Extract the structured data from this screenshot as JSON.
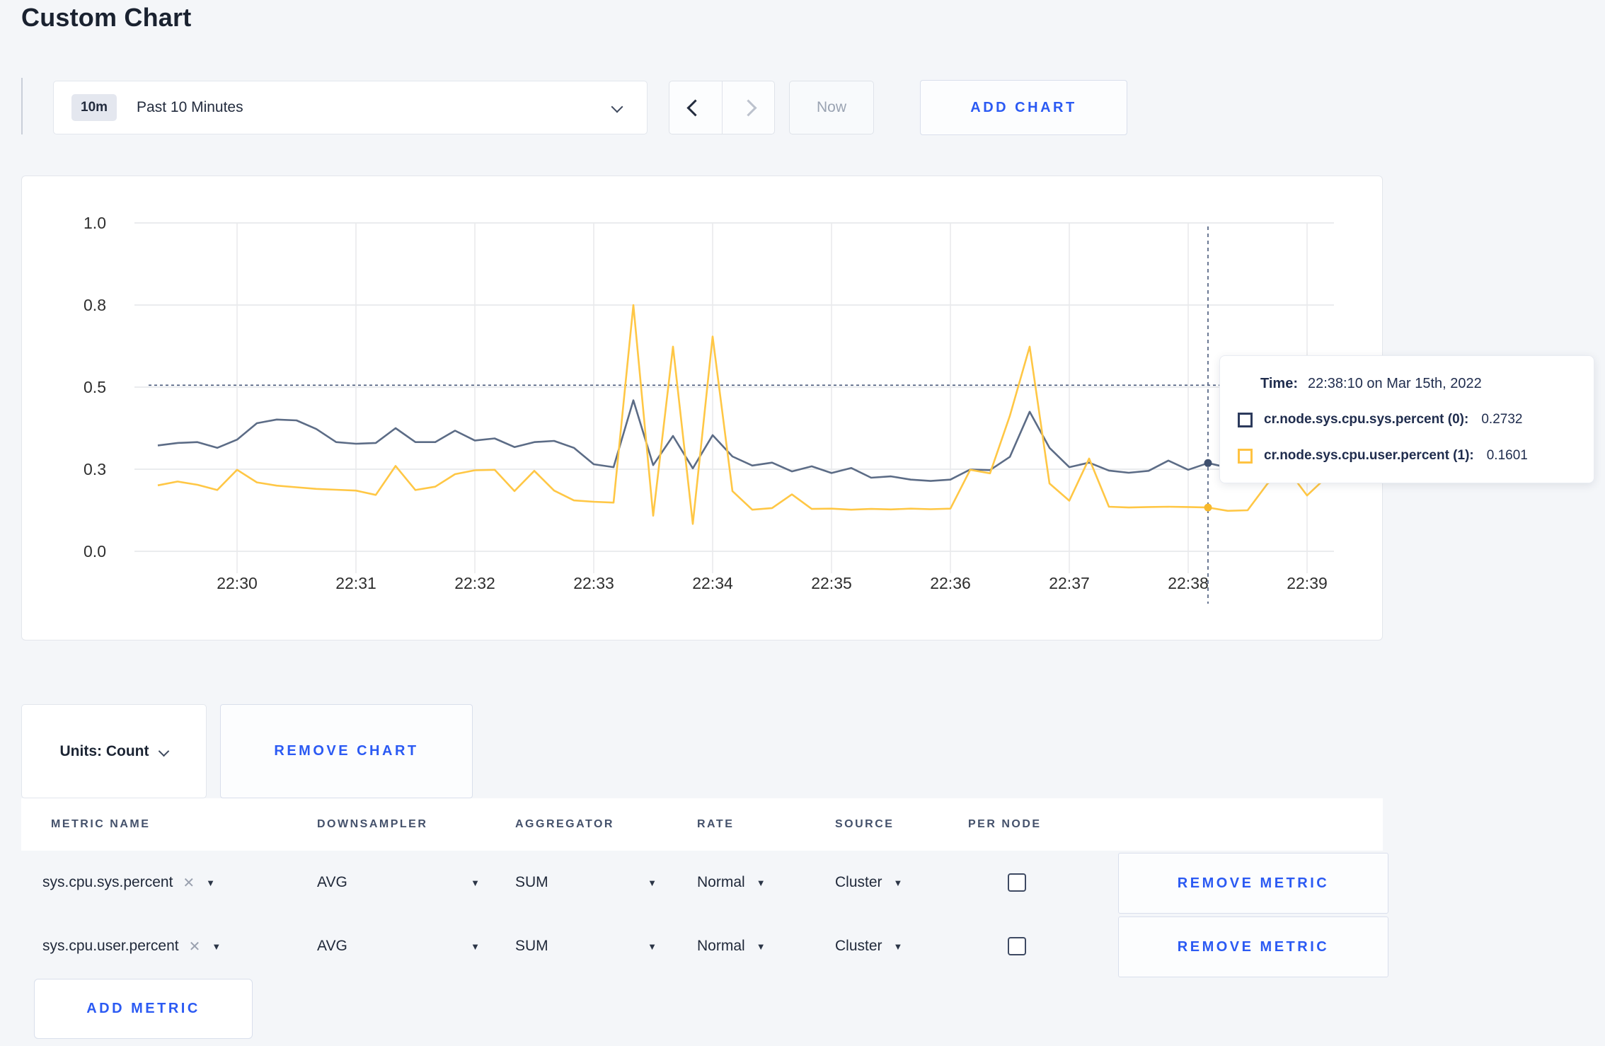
{
  "page_title": "Custom Chart",
  "colors": {
    "accent_blue": "#2b5af3",
    "series_sys": "#5c6c86",
    "series_user": "#ffc745",
    "crosshair": "#47587a",
    "grid": "#e4e6e8"
  },
  "toolbar": {
    "time_badge": "10m",
    "time_label": "Past 10 Minutes",
    "now_label": "Now",
    "add_chart_label": "ADD CHART"
  },
  "chart_controls": {
    "units_label": "Units: Count",
    "remove_chart_label": "REMOVE CHART"
  },
  "tooltip": {
    "time_label": "Time:",
    "time_value": "22:38:10 on Mar 15th, 2022",
    "rows": [
      {
        "label": "cr.node.sys.cpu.sys.percent (0):",
        "value": "0.2732",
        "color": "#2c3a5c"
      },
      {
        "label": "cr.node.sys.cpu.user.percent (1):",
        "value": "0.1601",
        "color": "#ffc342"
      }
    ]
  },
  "chart_data": {
    "type": "line",
    "title": "",
    "xlabel": "",
    "ylabel": "",
    "y_ticks": [
      0.0,
      0.3,
      0.5,
      0.8,
      1.0
    ],
    "y_ticks_evenly_spaced": true,
    "x_tick_labels": [
      "22:30",
      "22:31",
      "22:32",
      "22:33",
      "22:34",
      "22:35",
      "22:36",
      "22:37",
      "22:38",
      "22:39"
    ],
    "points_start_offset_sec": -40,
    "points_step_sec": 10,
    "series": [
      {
        "name": "cr.node.sys.cpu.sys.percent",
        "color": "#5c6c86",
        "values": [
          0.358,
          0.364,
          0.366,
          0.352,
          0.372,
          0.412,
          0.421,
          0.419,
          0.398,
          0.366,
          0.362,
          0.364,
          0.4,
          0.366,
          0.366,
          0.394,
          0.37,
          0.375,
          0.354,
          0.366,
          0.369,
          0.352,
          0.312,
          0.305,
          0.468,
          0.31,
          0.381,
          0.302,
          0.383,
          0.331,
          0.309,
          0.316,
          0.292,
          0.307,
          0.286,
          0.303,
          0.269,
          0.274,
          0.262,
          0.257,
          0.262,
          0.299,
          0.297,
          0.33,
          0.44,
          0.352,
          0.305,
          0.316,
          0.295,
          0.287,
          0.294,
          0.321,
          0.298,
          0.315,
          0.304,
          0.296,
          0.301,
          0.296,
          0.3,
          0.297
        ]
      },
      {
        "name": "cr.node.sys.cpu.user.percent",
        "color": "#ffc745",
        "values": [
          0.241,
          0.255,
          0.243,
          0.224,
          0.298,
          0.252,
          0.24,
          0.234,
          0.228,
          0.225,
          0.222,
          0.206,
          0.308,
          0.224,
          0.236,
          0.282,
          0.296,
          0.298,
          0.22,
          0.294,
          0.222,
          0.186,
          0.181,
          0.178,
          0.8,
          0.13,
          0.648,
          0.1,
          0.685,
          0.22,
          0.152,
          0.158,
          0.208,
          0.155,
          0.156,
          0.152,
          0.155,
          0.153,
          0.156,
          0.154,
          0.156,
          0.298,
          0.285,
          0.43,
          0.648,
          0.248,
          0.185,
          0.326,
          0.163,
          0.16,
          0.162,
          0.163,
          0.162,
          0.16,
          0.148,
          0.15,
          0.247,
          0.3,
          0.204,
          0.272
        ]
      }
    ],
    "crosshair": {
      "point_index": 53,
      "time_label": "22:38:10",
      "hline_value": 0.507
    },
    "grid": true,
    "legend_position": "tooltip"
  },
  "metrics": {
    "headers": [
      "METRIC NAME",
      "DOWNSAMPLER",
      "AGGREGATOR",
      "RATE",
      "SOURCE",
      "PER NODE"
    ],
    "rows": [
      {
        "name": "sys.cpu.sys.percent",
        "downsampler": "AVG",
        "aggregator": "SUM",
        "rate": "Normal",
        "source": "Cluster",
        "per_node": false,
        "remove_label": "REMOVE METRIC"
      },
      {
        "name": "sys.cpu.user.percent",
        "downsampler": "AVG",
        "aggregator": "SUM",
        "rate": "Normal",
        "source": "Cluster",
        "per_node": false,
        "remove_label": "REMOVE METRIC"
      }
    ],
    "add_metric_label": "ADD METRIC",
    "clear_icon": "✕",
    "dropdown_icon": "▼"
  }
}
